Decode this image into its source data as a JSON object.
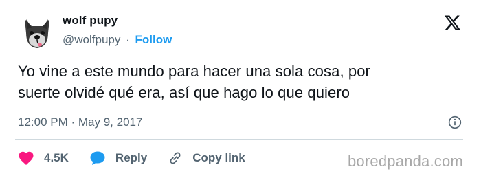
{
  "tweet": {
    "author": {
      "display_name": "wolf pupy",
      "handle": "@wolfpupy",
      "avatar_icon": "wolf-pup-avatar"
    },
    "follow_label": "Follow",
    "separator": "·",
    "text_line1": "Yo vine a este mundo para hacer una sola cosa, por",
    "text_line2": "suerte olvidé qué era, así que hago lo que quiero",
    "timestamp": "12:00 PM · May 9, 2017",
    "actions": {
      "likes_count": "4.5K",
      "reply_label": "Reply",
      "copy_link_label": "Copy link"
    }
  },
  "icons": {
    "brand": "x-logo-icon",
    "info": "info-icon",
    "like": "heart-icon",
    "reply": "reply-bubble-icon",
    "copy": "link-icon"
  },
  "colors": {
    "accent": "#1d9bf0",
    "like": "#f91880",
    "text_primary": "#0f1419",
    "text_secondary": "#536471",
    "divider": "#cfd9de"
  },
  "watermark": "boredpanda.com"
}
